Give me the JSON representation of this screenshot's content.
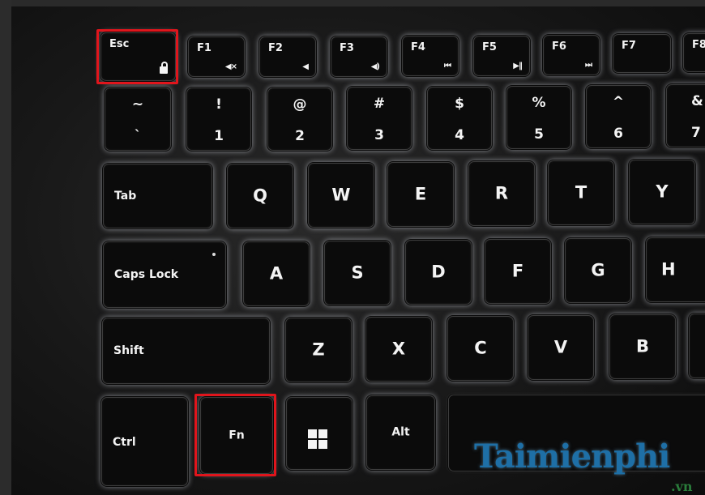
{
  "keyboard": {
    "function_row": [
      {
        "label": "Esc",
        "icon": "lock-icon"
      },
      {
        "label": "F1",
        "icon_glyph": "◀×",
        "icon": "mute-icon"
      },
      {
        "label": "F2",
        "icon_glyph": "◀",
        "icon": "volume-down-icon"
      },
      {
        "label": "F3",
        "icon_glyph": "◀)",
        "icon": "volume-up-icon"
      },
      {
        "label": "F4",
        "icon_glyph": "⏮",
        "icon": "previous-track-icon"
      },
      {
        "label": "F5",
        "icon_glyph": "▶‖",
        "icon": "play-pause-icon"
      },
      {
        "label": "F6",
        "icon_glyph": "⏭",
        "icon": "next-track-icon"
      },
      {
        "label": "F7"
      },
      {
        "label": "F8"
      }
    ],
    "number_row": [
      {
        "upper": "~",
        "lower": "`"
      },
      {
        "upper": "!",
        "lower": "1"
      },
      {
        "upper": "@",
        "lower": "2"
      },
      {
        "upper": "#",
        "lower": "3"
      },
      {
        "upper": "$",
        "lower": "4"
      },
      {
        "upper": "%",
        "lower": "5"
      },
      {
        "upper": "^",
        "lower": "6"
      },
      {
        "upper": "&",
        "lower": "7"
      }
    ],
    "qwerty_row": {
      "modifier": "Tab",
      "letters": [
        "Q",
        "W",
        "E",
        "R",
        "T",
        "Y"
      ]
    },
    "home_row": {
      "modifier": "Caps Lock",
      "letters": [
        "A",
        "S",
        "D",
        "F",
        "G",
        "H"
      ]
    },
    "shift_row": {
      "modifier": "Shift",
      "letters": [
        "Z",
        "X",
        "C",
        "V",
        "B"
      ]
    },
    "bottom_row": {
      "ctrl": "Ctrl",
      "fn": "Fn",
      "windows_icon": "windows-icon",
      "alt": "Alt"
    }
  },
  "highlight_color": "#e0151c",
  "watermark": {
    "text": "Taimienphi",
    "sub": ".vn"
  }
}
